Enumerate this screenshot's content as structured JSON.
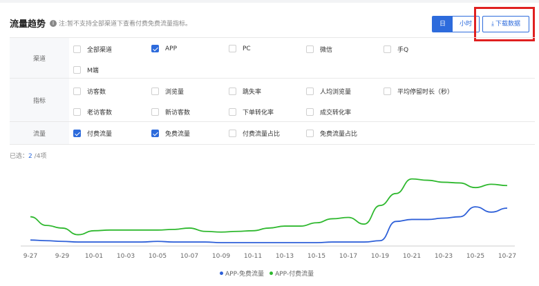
{
  "header": {
    "title": "流量趋势",
    "note": "注:暂不支持全部渠道下查看付费免费流量指标。",
    "toggle": {
      "day": "日",
      "hour": "小时"
    },
    "download_label": "下载数据"
  },
  "filters": {
    "channel": {
      "label": "渠道",
      "options": [
        {
          "label": "全部渠道",
          "checked": false
        },
        {
          "label": "APP",
          "checked": true
        },
        {
          "label": "PC",
          "checked": false
        },
        {
          "label": "微信",
          "checked": false
        },
        {
          "label": "手Q",
          "checked": false
        },
        {
          "label": "M端",
          "checked": false
        }
      ]
    },
    "metric": {
      "label": "指标",
      "options": [
        {
          "label": "访客数",
          "checked": false
        },
        {
          "label": "浏览量",
          "checked": false
        },
        {
          "label": "跳失率",
          "checked": false
        },
        {
          "label": "人均浏览量",
          "checked": false
        },
        {
          "label": "平均停留时长（秒）",
          "checked": false
        },
        {
          "label": "老访客数",
          "checked": false
        },
        {
          "label": "新访客数",
          "checked": false
        },
        {
          "label": "下单转化率",
          "checked": false
        },
        {
          "label": "成交转化率",
          "checked": false
        }
      ]
    },
    "traffic": {
      "label": "流量",
      "options": [
        {
          "label": "付费流量",
          "checked": true
        },
        {
          "label": "免费流量",
          "checked": true
        },
        {
          "label": "付费流量占比",
          "checked": false
        },
        {
          "label": "免费流量占比",
          "checked": false
        }
      ]
    }
  },
  "selected": {
    "prefix": "已选：",
    "count": "2",
    "suffix": " /4项"
  },
  "colors": {
    "accent": "#2d6bdc",
    "paid": "#2eb82e",
    "free": "#2d5fd8",
    "highlight": "#e02020"
  },
  "chart_data": {
    "type": "line",
    "title": "",
    "xlabel": "",
    "ylabel": "",
    "x": [
      "9-27",
      "9-28",
      "9-29",
      "9-30",
      "10-01",
      "10-02",
      "10-03",
      "10-04",
      "10-05",
      "10-06",
      "10-07",
      "10-08",
      "10-09",
      "10-10",
      "10-11",
      "10-12",
      "10-13",
      "10-14",
      "10-15",
      "10-16",
      "10-17",
      "10-18",
      "10-19",
      "10-20",
      "10-21",
      "10-22",
      "10-23",
      "10-24",
      "10-25",
      "10-26",
      "10-27"
    ],
    "xticks": [
      "9-27",
      "9-29",
      "10-01",
      "10-03",
      "10-05",
      "10-07",
      "10-09",
      "10-11",
      "10-13",
      "10-15",
      "10-17",
      "10-19",
      "10-21",
      "10-23",
      "10-25",
      "10-27"
    ],
    "ylim": [
      0,
      110
    ],
    "grid": false,
    "legend_position": "bottom",
    "series": [
      {
        "name": "APP-免费流量",
        "color": "#2d5fd8",
        "values": [
          8,
          7,
          6,
          5,
          5,
          5,
          5,
          5,
          6,
          5,
          5,
          5,
          4,
          4,
          4,
          4,
          4,
          4,
          4,
          5,
          5,
          5,
          7,
          36,
          39,
          39,
          41,
          43,
          58,
          50,
          56
        ]
      },
      {
        "name": "APP-付费流量",
        "color": "#2eb82e",
        "values": [
          43,
          30,
          26,
          16,
          22,
          23,
          23,
          23,
          23,
          24,
          26,
          21,
          20,
          21,
          22,
          26,
          29,
          29,
          34,
          40,
          42,
          32,
          60,
          78,
          100,
          98,
          95,
          94,
          87,
          92,
          90
        ]
      }
    ]
  }
}
